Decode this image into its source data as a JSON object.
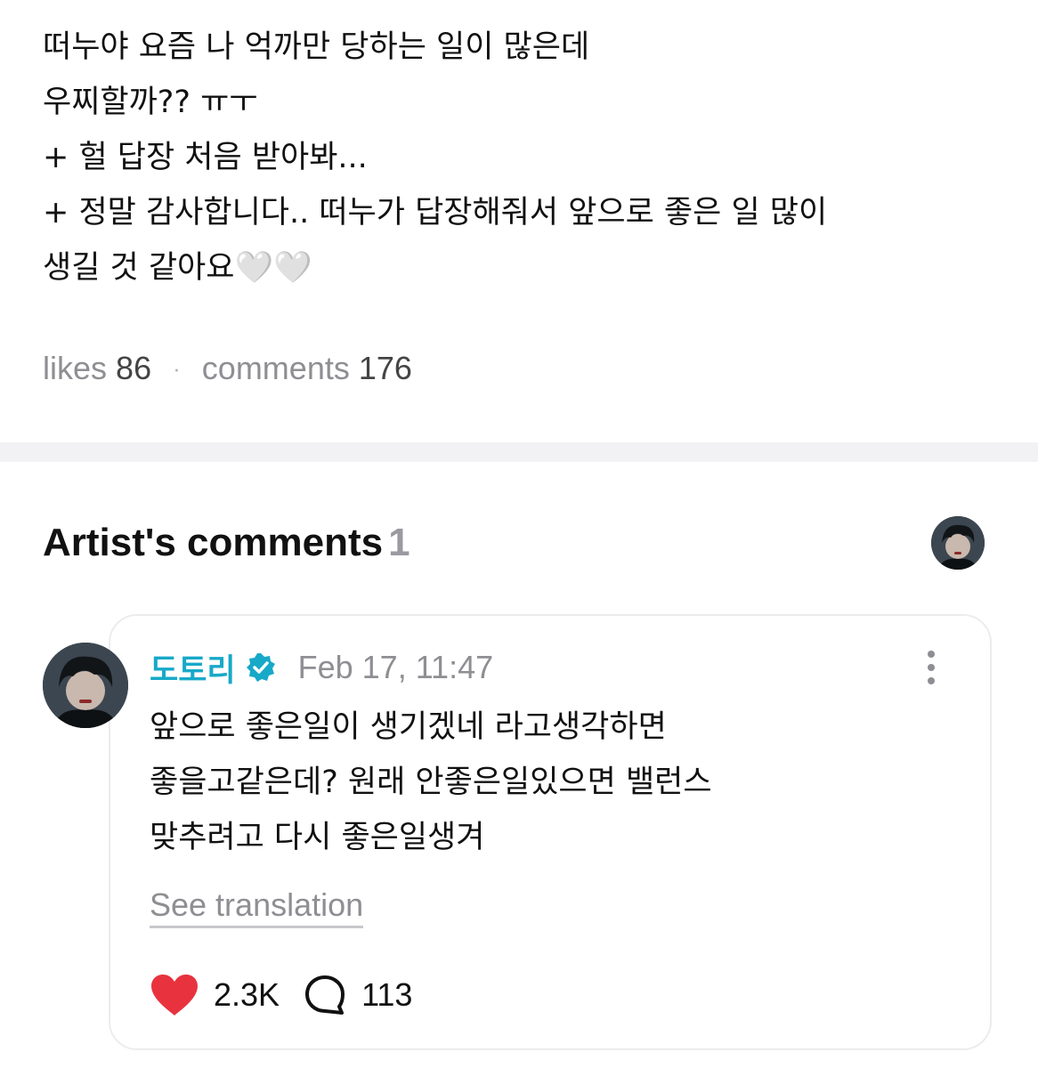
{
  "post": {
    "lines": [
      "떠누야 요즘 나 억까만 당하는 일이 많은데",
      "우찌할까?? ㅠㅜ",
      "+ 헐 답장 처음 받아봐...",
      "+ 정말 감사합니다.. 떠누가 답장해줘서 앞으로 좋은 일 많이",
      "생길 것 같아요🤍🤍"
    ],
    "stats": {
      "likes_label": "likes",
      "likes_count": "86",
      "separator": "·",
      "comments_label": "comments",
      "comments_count": "176"
    }
  },
  "artist_comments": {
    "title": "Artist's comments",
    "count": "1",
    "header_avatar_icon": "artist-avatar",
    "comment": {
      "author": "도토리",
      "verified_icon": "verified-badge-icon",
      "timestamp": "Feb 17, 11:47",
      "lines": [
        "앞으로 좋은일이 생기겠네 라고생각하면",
        "좋을고같은데? 원래 안좋은일있으면 밸런스",
        "맞추려고 다시 좋은일생겨"
      ],
      "see_translation": "See translation",
      "like_count": "2.3K",
      "reply_count": "113",
      "like_icon": "heart-icon",
      "reply_icon": "speech-bubble-icon",
      "more_icon": "more-vertical-icon"
    }
  },
  "colors": {
    "accent": "#17a9c8",
    "heart": "#e8333f",
    "muted": "#8e8e93",
    "divider": "#f2f2f4"
  }
}
